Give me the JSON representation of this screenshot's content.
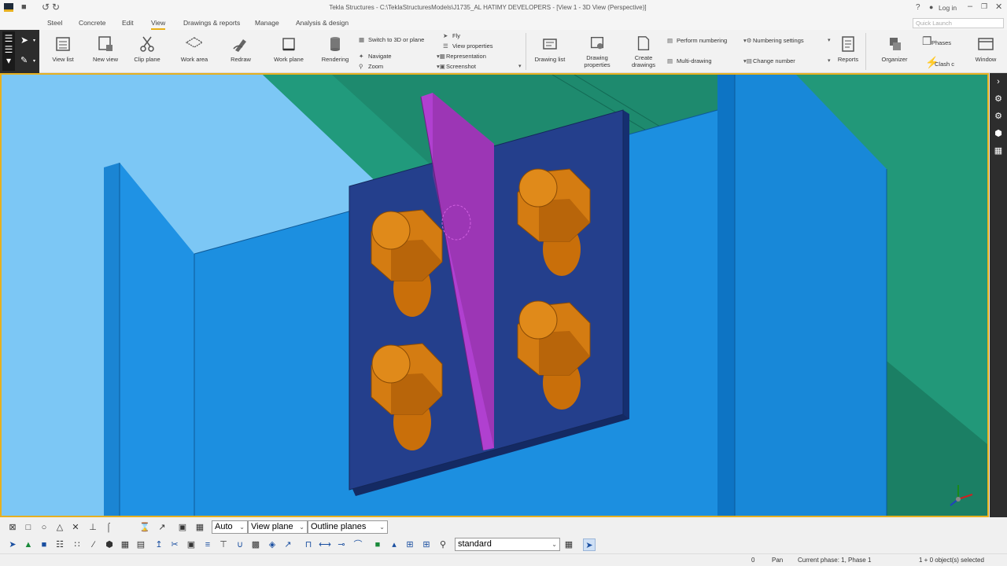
{
  "window": {
    "title": "Tekla Structures - C:\\TeklaStructuresModels\\J1735_AL HATIMY DEVELOPERS  - [View 1 - 3D View (Perspective)]",
    "help": "?",
    "login": "Log in",
    "quick_launch_placeholder": "Quick Launch"
  },
  "menu": {
    "items": [
      "Steel",
      "Concrete",
      "Edit",
      "View",
      "Drawings & reports",
      "Manage",
      "Analysis & design"
    ],
    "active": "View"
  },
  "ribbon": {
    "view_list": "View list",
    "new_view": "New view",
    "clip_plane": "Clip plane",
    "work_area": "Work area",
    "redraw": "Redraw",
    "work_plane": "Work plane",
    "rendering": "Rendering",
    "switch_3d": "Switch to 3D or plane",
    "navigate": "Navigate",
    "zoom": "Zoom",
    "fly": "Fly",
    "view_properties": "View properties",
    "representation": "Representation",
    "screenshot": "Screenshot",
    "drawing_list": "Drawing list",
    "drawing_properties_1": "Drawing",
    "drawing_properties_2": "properties",
    "create_drawings_1": "Create",
    "create_drawings_2": "drawings",
    "perform_numbering": "Perform numbering",
    "multi_drawing": "Multi-drawing",
    "numbering_settings": "Numbering settings",
    "change_number": "Change number",
    "reports": "Reports",
    "organizer": "Organizer",
    "phases": "Phases",
    "clash": "Clash c",
    "window": "Window"
  },
  "toolbar": {
    "snap_auto": "Auto",
    "plane": "View plane",
    "outline": "Outline planes",
    "filter": "standard"
  },
  "status": {
    "count": "0",
    "mode": "Pan",
    "phase": "Current phase: 1, Phase 1",
    "selection": "1 + 0 object(s) selected"
  },
  "colors": {
    "accent": "#e6b020",
    "beam_blue": "#1b8ede",
    "plate_navy": "#223f8c",
    "stiffener_magenta": "#a634c4",
    "bolt_orange": "#d27a10",
    "slab_green": "#1e8a6e",
    "sky": "#7cc7f5"
  },
  "icons": [
    "menu-icon",
    "save-icon",
    "undo-icon",
    "redo-icon",
    "help-icon",
    "user-icon",
    "minimize-icon",
    "restore-icon",
    "close-icon",
    "pointer-icon",
    "view-list-icon",
    "new-view-icon",
    "scissors-icon",
    "work-area-icon",
    "redraw-icon",
    "work-plane-icon",
    "rendering-icon",
    "reports-icon",
    "organizer-icon",
    "window-icon",
    "axis-gizmo-icon"
  ]
}
